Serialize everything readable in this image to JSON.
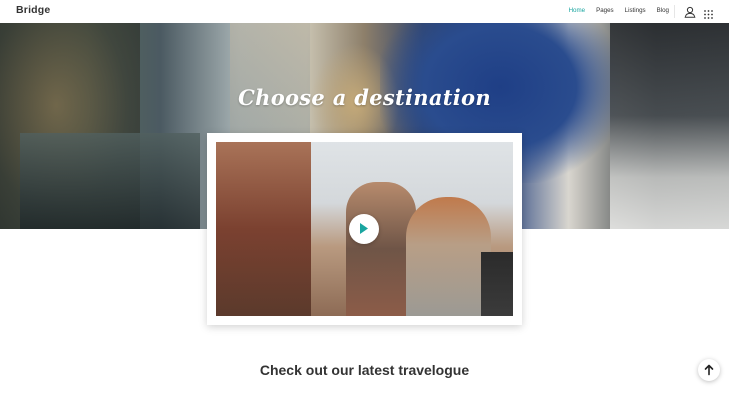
{
  "header": {
    "logo": "Bridge",
    "nav": [
      {
        "label": "Home",
        "active": true
      },
      {
        "label": "Pages",
        "active": false
      },
      {
        "label": "Listings",
        "active": false
      },
      {
        "label": "Blog",
        "active": false
      }
    ],
    "icons": [
      "user-icon",
      "grid-menu-icon"
    ]
  },
  "hero": {
    "title": "Choose a destination"
  },
  "video": {
    "icon": "play-icon"
  },
  "section": {
    "title": "Check out our latest travelogue"
  },
  "back_to_top": {
    "icon": "arrow-up-icon"
  },
  "colors": {
    "accent": "#1aa5a0",
    "text": "#333333",
    "background": "#ffffff"
  }
}
